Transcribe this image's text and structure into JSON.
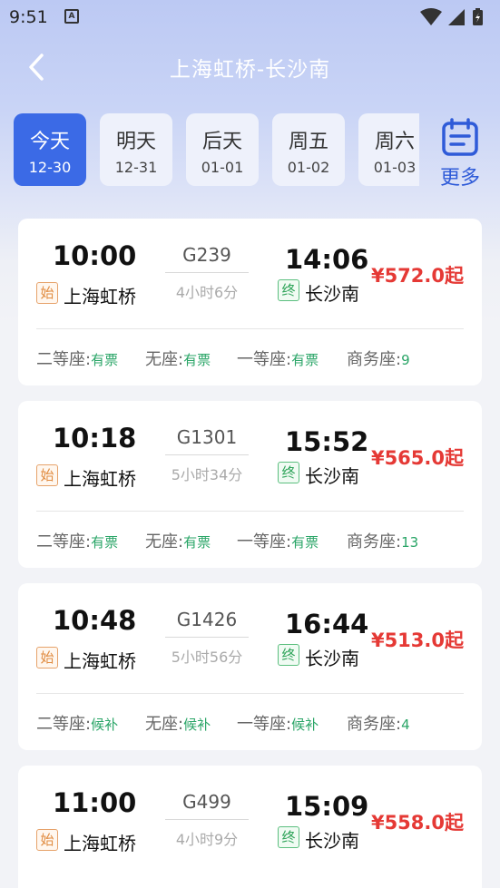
{
  "status_bar": {
    "time": "9:51",
    "notif_icon_letter": "A"
  },
  "nav": {
    "title": "上海虹桥-长沙南"
  },
  "date_tabs": [
    {
      "day": "今天",
      "date": "12-30",
      "active": true
    },
    {
      "day": "明天",
      "date": "12-31",
      "active": false
    },
    {
      "day": "后天",
      "date": "01-01",
      "active": false
    },
    {
      "day": "周五",
      "date": "01-02",
      "active": false
    },
    {
      "day": "周六",
      "date": "01-03",
      "active": false
    }
  ],
  "more": {
    "label": "更多",
    "icon": "calendar-icon"
  },
  "trains": [
    {
      "dep_time": "10:00",
      "train_no": "G239",
      "duration": "4小时6分",
      "arr_time": "14:06",
      "start_badge": "始",
      "dep_station": "上海虹桥",
      "end_badge": "终",
      "arr_station": "长沙南",
      "price": "¥572.0起",
      "seats": [
        {
          "name": "二等座:",
          "status": "有票"
        },
        {
          "name": "无座:",
          "status": "有票"
        },
        {
          "name": "一等座:",
          "status": "有票"
        },
        {
          "name": "商务座:",
          "status": "9"
        }
      ]
    },
    {
      "dep_time": "10:18",
      "train_no": "G1301",
      "duration": "5小时34分",
      "arr_time": "15:52",
      "start_badge": "始",
      "dep_station": "上海虹桥",
      "end_badge": "终",
      "arr_station": "长沙南",
      "price": "¥565.0起",
      "seats": [
        {
          "name": "二等座:",
          "status": "有票"
        },
        {
          "name": "无座:",
          "status": "有票"
        },
        {
          "name": "一等座:",
          "status": "有票"
        },
        {
          "name": "商务座:",
          "status": "13"
        }
      ]
    },
    {
      "dep_time": "10:48",
      "train_no": "G1426",
      "duration": "5小时56分",
      "arr_time": "16:44",
      "start_badge": "始",
      "dep_station": "上海虹桥",
      "end_badge": "终",
      "arr_station": "长沙南",
      "price": "¥513.0起",
      "seats": [
        {
          "name": "二等座:",
          "status": "候补"
        },
        {
          "name": "无座:",
          "status": "候补"
        },
        {
          "name": "一等座:",
          "status": "候补"
        },
        {
          "name": "商务座:",
          "status": "4"
        }
      ]
    },
    {
      "dep_time": "11:00",
      "train_no": "G499",
      "duration": "4小时9分",
      "arr_time": "15:09",
      "start_badge": "始",
      "dep_station": "上海虹桥",
      "end_badge": "终",
      "arr_station": "长沙南",
      "price": "¥558.0起",
      "seats": []
    }
  ],
  "colors": {
    "accent": "#3b6ae6",
    "price": "#e53935",
    "available": "#2aa567"
  }
}
